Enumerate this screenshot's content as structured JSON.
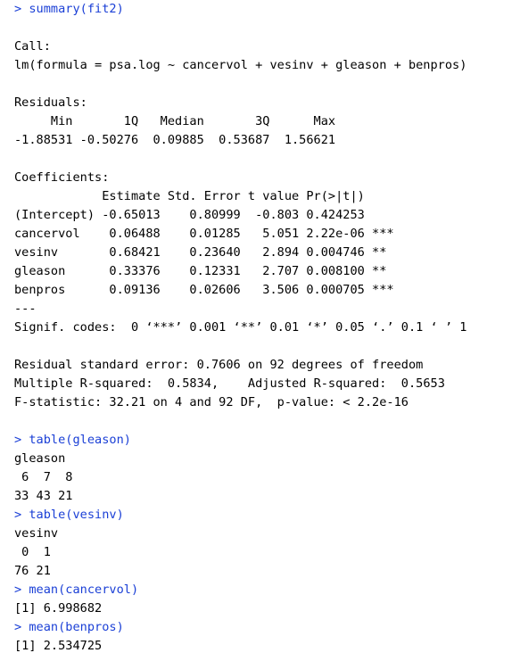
{
  "colors": {
    "background": "#ffffff",
    "command": "#1a3fd6",
    "output": "#000000"
  },
  "console": {
    "cmd_summary": "> summary(fit2)",
    "call_label": "Call:",
    "call_formula": "lm(formula = psa.log ~ cancervol + vesinv + gleason + benpros)",
    "residuals_label": "Residuals:",
    "residuals_header": "     Min       1Q   Median       3Q      Max ",
    "residuals_values": "-1.88531 -0.50276  0.09885  0.53687  1.56621 ",
    "coef_label": "Coefficients:",
    "coef_header": "            Estimate Std. Error t value Pr(>|t|)    ",
    "coef_rows": [
      "(Intercept) -0.65013    0.80999  -0.803 0.424253    ",
      "cancervol    0.06488    0.01285   5.051 2.22e-06 ***",
      "vesinv       0.68421    0.23640   2.894 0.004746 ** ",
      "gleason      0.33376    0.12331   2.707 0.008100 ** ",
      "benpros      0.09136    0.02606   3.506 0.000705 ***"
    ],
    "signif_sep": "---",
    "signif_codes": "Signif. codes:  0 ‘***’ 0.001 ‘**’ 0.01 ‘*’ 0.05 ‘.’ 0.1 ‘ ’ 1",
    "rse": "Residual standard error: 0.7606 on 92 degrees of freedom",
    "rsq": "Multiple R-squared:  0.5834,\tAdjusted R-squared:  0.5653 ",
    "fstat": "F-statistic: 32.21 on 4 and 92 DF,  p-value: < 2.2e-16",
    "cmd_table_gleason": "> table(gleason)",
    "gleason_name": "gleason",
    "gleason_levels": " 6  7  8 ",
    "gleason_counts": "33 43 21 ",
    "cmd_table_vesinv": "> table(vesinv)",
    "vesinv_name": "vesinv",
    "vesinv_levels": " 0  1 ",
    "vesinv_counts": "76 21 ",
    "cmd_mean_cancervol": "> mean(cancervol)",
    "mean_cancervol": "[1] 6.998682",
    "cmd_mean_benpros": "> mean(benpros)",
    "mean_benpros": "[1] 2.534725"
  }
}
